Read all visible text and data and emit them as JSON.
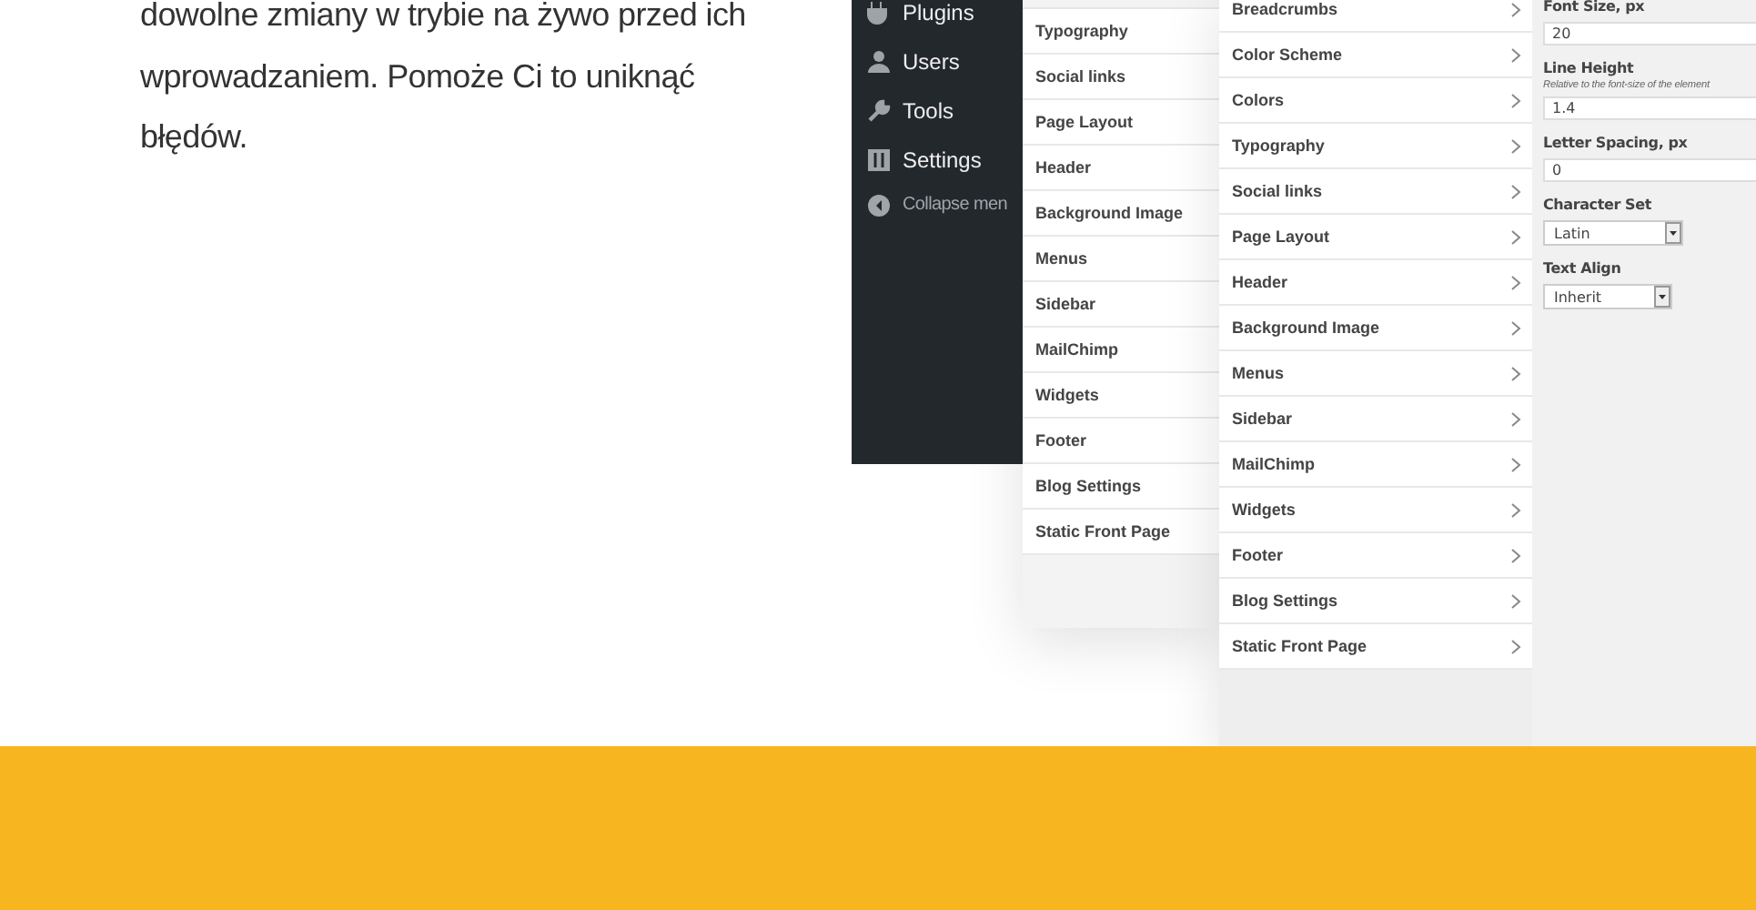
{
  "intro": {
    "text": "dowolne zmiany w trybie na żywo przed ich wprowadzaniem. Pomoże Ci to uniknąć błędów."
  },
  "admin_menu": {
    "items": [
      {
        "label": "Plugins"
      },
      {
        "label": "Users"
      },
      {
        "label": "Tools"
      },
      {
        "label": "Settings"
      },
      {
        "label": "Collapse men"
      }
    ]
  },
  "customizer_panel": {
    "items": [
      "Typography",
      "Social links",
      "Page Layout",
      "Header",
      "Background Image",
      "Menus",
      "Sidebar",
      "MailChimp",
      "Widgets",
      "Footer",
      "Blog Settings",
      "Static Front Page"
    ]
  },
  "sections_panel": {
    "items": [
      "Breadcrumbs",
      "Color Scheme",
      "Colors",
      "Typography",
      "Social links",
      "Page Layout",
      "Header",
      "Background Image",
      "Menus",
      "Sidebar",
      "MailChimp",
      "Widgets",
      "Footer",
      "Blog Settings",
      "Static Front Page"
    ]
  },
  "typography_panel": {
    "fields": [
      {
        "kind": "text",
        "label": "Font Size, px",
        "value": "20"
      },
      {
        "kind": "text",
        "label": "Line Height",
        "hint": "Relative to the font-size of the element",
        "value": "1.4"
      },
      {
        "kind": "text",
        "label": "Letter Spacing, px",
        "value": "0"
      },
      {
        "kind": "select",
        "label": "Character Set",
        "value": "Latin"
      },
      {
        "kind": "select",
        "label": "Text Align",
        "value": "Inherit"
      }
    ]
  }
}
